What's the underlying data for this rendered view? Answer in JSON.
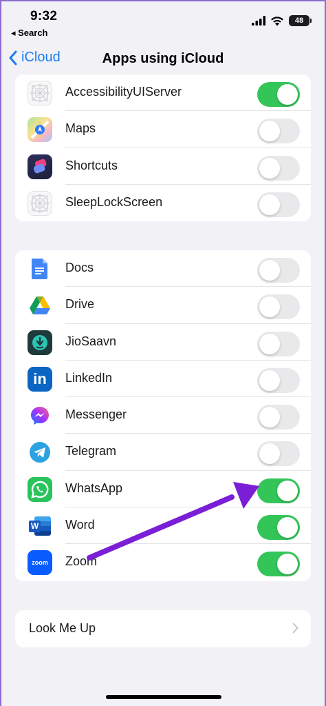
{
  "status": {
    "time": "9:32",
    "back_app": "◂ Search",
    "battery": "48"
  },
  "nav": {
    "back_label": "iCloud",
    "title": "Apps using iCloud"
  },
  "group1": [
    {
      "label": "AccessibilityUIServer",
      "on": true,
      "icon": "accessibility-placeholder-icon"
    },
    {
      "label": "Maps",
      "on": false,
      "icon": "maps-icon"
    },
    {
      "label": "Shortcuts",
      "on": false,
      "icon": "shortcuts-icon"
    },
    {
      "label": "SleepLockScreen",
      "on": false,
      "icon": "sleeplock-placeholder-icon"
    }
  ],
  "group2": [
    {
      "label": "Docs",
      "on": false,
      "icon": "google-docs-icon"
    },
    {
      "label": "Drive",
      "on": false,
      "icon": "google-drive-icon"
    },
    {
      "label": "JioSaavn",
      "on": false,
      "icon": "jiosaavn-icon"
    },
    {
      "label": "LinkedIn",
      "on": false,
      "icon": "linkedin-icon"
    },
    {
      "label": "Messenger",
      "on": false,
      "icon": "messenger-icon"
    },
    {
      "label": "Telegram",
      "on": false,
      "icon": "telegram-icon"
    },
    {
      "label": "WhatsApp",
      "on": true,
      "icon": "whatsapp-icon"
    },
    {
      "label": "Word",
      "on": true,
      "icon": "word-icon"
    },
    {
      "label": "Zoom",
      "on": true,
      "icon": "zoom-icon"
    }
  ],
  "lookup": {
    "label": "Look Me Up"
  },
  "icon_text": {
    "linkedin": "in",
    "word": "W",
    "zoom": "zoom"
  },
  "colors": {
    "toggle_on": "#34c559",
    "accent": "#1a7cf5",
    "annotation_arrow": "#7a1fd6"
  }
}
